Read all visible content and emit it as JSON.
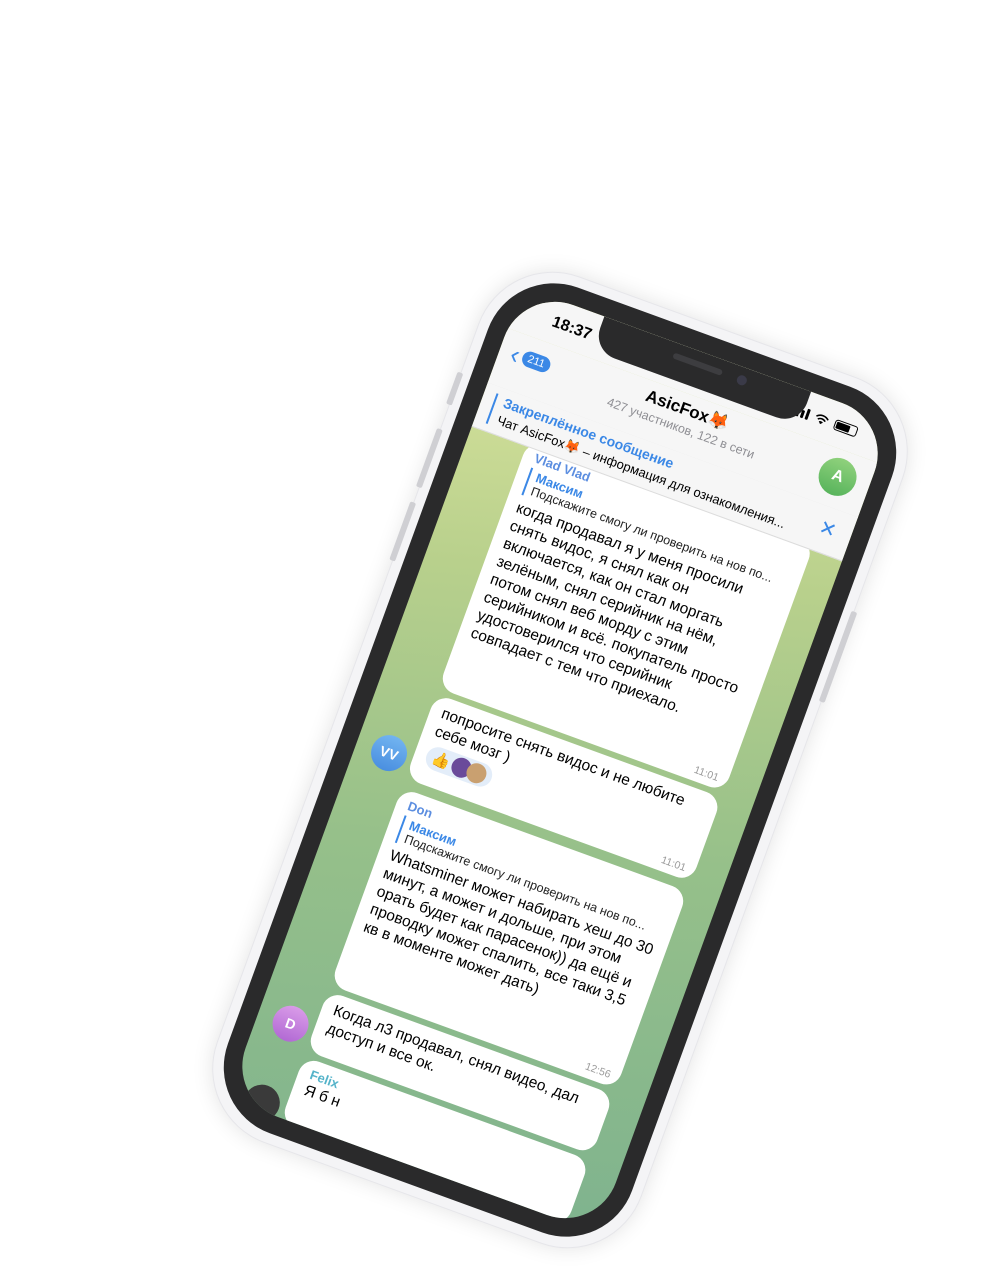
{
  "status": {
    "time": "18:37"
  },
  "header": {
    "back_count": "211",
    "title": "AsicFox🦊",
    "subtitle": "427 участников, 122 в сети",
    "avatar_letter": "A"
  },
  "pinned": {
    "title": "Закреплённое сообщение",
    "text": "Чат AsicFox🦊 – информация для ознакомления..."
  },
  "messages": {
    "m1": {
      "sender": "Vlad Vlad",
      "quote_name": "Максим",
      "quote_text": "Подскажите смогу ли проверить на нов по...",
      "text": "когда продавал я у меня просили снять видос, я снял как он включается, как он стал моргать зелёным, снял серийник на нём, потом снял веб морду с этим серийником и всё. покупатель просто удостоверился что серийник совпадает с тем что приехало.",
      "time": "11:01"
    },
    "m2": {
      "text": "попросите снять видос и не любите себе мозг )",
      "time": "11:01",
      "reaction": "👍",
      "avatar": "VV"
    },
    "m3": {
      "sender": "Don",
      "quote_name": "Максим",
      "quote_text": "Подскажите смогу ли проверить на нов по...",
      "text": "Whatsminer может набирать хеш до 30 минут, а может и дольше, при этом орать будет как парасенок)) да ещё и проводку может спалить, все таки 3,5 кв в моменте может дать)",
      "time": "12:56"
    },
    "m4": {
      "text": "Когда л3 продавал, снял видео, дал доступ и все ок.",
      "avatar": "D"
    },
    "m5": {
      "sender": "Felix",
      "text": "Я б н"
    }
  }
}
